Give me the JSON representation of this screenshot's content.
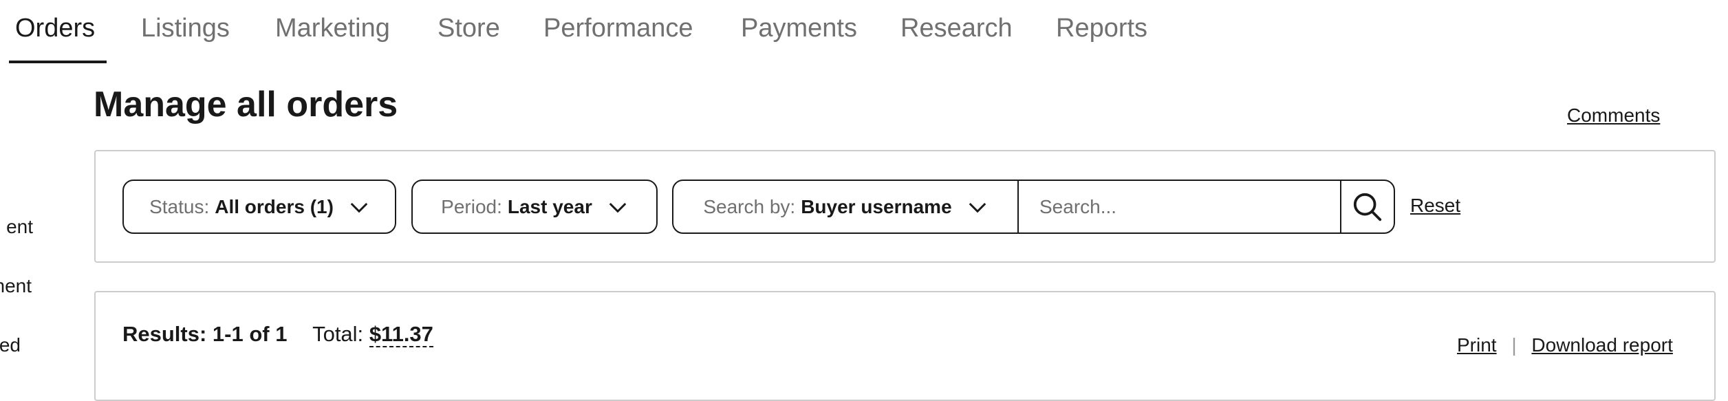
{
  "tabs": [
    {
      "label": "Orders",
      "active": true
    },
    {
      "label": "Listings"
    },
    {
      "label": "Marketing"
    },
    {
      "label": "Store"
    },
    {
      "label": "Performance"
    },
    {
      "label": "Payments"
    },
    {
      "label": "Research"
    },
    {
      "label": "Reports"
    }
  ],
  "sidebar": {
    "items": [
      {
        "label": "ent"
      },
      {
        "label": "nent"
      },
      {
        "label": "ed"
      }
    ]
  },
  "page": {
    "title": "Manage all orders",
    "comments_link": "Comments"
  },
  "filters": {
    "status": {
      "label": "Status:",
      "value": "All orders (1)"
    },
    "period": {
      "label": "Period:",
      "value": "Last year"
    },
    "search_by": {
      "label": "Search by:",
      "value": "Buyer username"
    },
    "search_placeholder": "Search...",
    "search_icon": "magnifier-icon",
    "reset_label": "Reset"
  },
  "results": {
    "summary": "Results: 1-1 of 1",
    "total_label": "Total:",
    "total_value": "$11.37",
    "print_label": "Print",
    "separator": "|",
    "download_label": "Download report"
  }
}
